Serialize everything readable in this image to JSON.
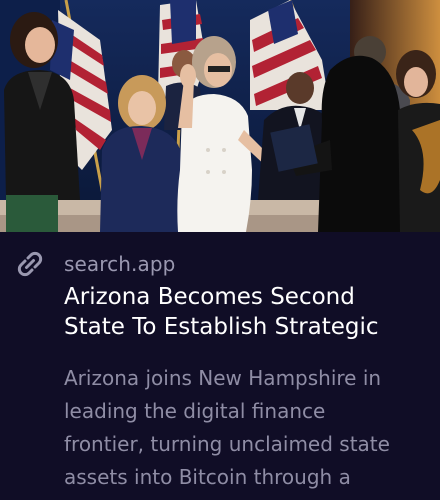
{
  "link_card": {
    "source": "search.app",
    "title_lines": [
      "Arizona Becomes Second",
      "State To Establish Strategic"
    ],
    "description_lines": [
      "Arizona joins New Hampshire in",
      "leading the digital finance",
      "frontier, turning unclaimed state",
      "assets into Bitcoin through a"
    ],
    "icon": "link-icon",
    "image": "photo-swearing-in-ceremony"
  },
  "colors": {
    "background": "#100d26",
    "source_text": "#9a98b0",
    "title_text": "#ffffff",
    "description_text": "#8f8da5"
  }
}
